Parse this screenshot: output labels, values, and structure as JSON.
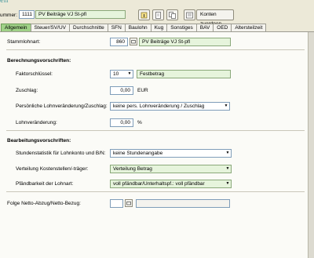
{
  "window": {
    "title_fragment": "en"
  },
  "header": {
    "number_label": "ummer:",
    "number_value": "1111",
    "name_value": "PV Beiträge VJ St-pfl",
    "assign_button_label": "Konten zuordnen",
    "tools": [
      "info-icon",
      "document-icon",
      "copy-icon"
    ]
  },
  "tabs": [
    "Allgemein",
    "Steuer/SV/UV",
    "Durchschnitte",
    "SFN",
    "Baulohn",
    "Kug",
    "Sonstiges",
    "BAV",
    "OED",
    "Altersteilzeit"
  ],
  "active_tab": "Allgemein",
  "form": {
    "stammlohnart_label": "Stammlohnart:",
    "stammlohnart_number": "860",
    "stammlohnart_name": "PV Beiträge VJ St-pfl",
    "berechnung_heading": "Berechnungsvorschriften:",
    "faktor_label": "Faktorschlüssel:",
    "faktor_value": "10",
    "faktor_text": "Festbetrag",
    "zuschlag_label": "Zuschlag:",
    "zuschlag_value": "0,00",
    "zuschlag_unit": "EUR",
    "lohnver_label": "Persönliche Lohnveränderung/Zuschlag:",
    "lohnver_value": "keine pers. Lohnveränderung / Zuschlag",
    "lohnveraenderung_label": "Lohnveränderung:",
    "lohnveraenderung_value": "0,00",
    "lohnveraenderung_unit": "%",
    "bearbeitung_heading": "Bearbeitungsvorschriften:",
    "stundenstat_label": "Stundenstatistik für Lohnkonto und B/N:",
    "stundenstat_value": "keine Stundenangabe",
    "verteilung_label": "Verteilung Kostenstellen/-träger:",
    "verteilung_value": "Verteilung Betrag",
    "pfaendbar_label": "Pfändbarkeit der Lohnart:",
    "pfaendbar_value": "voll pfändbar/Unterhaltspf.: voll pfändbar",
    "folge_label": "Folge Netto-Abzug/Netto-Bezug:",
    "folge_value": "",
    "folge_name": ""
  }
}
